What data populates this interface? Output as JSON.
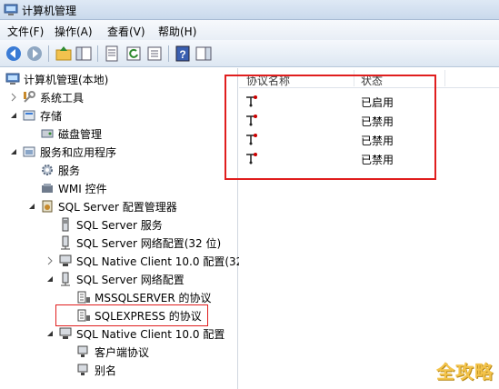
{
  "window": {
    "title": "计算机管理"
  },
  "menu": [
    "文件(F)",
    "操作(A)",
    "查看(V)",
    "帮助(H)"
  ],
  "tree": {
    "root": "计算机管理(本地)",
    "system_tools": "系统工具",
    "storage": "存储",
    "disk_mgmt": "磁盘管理",
    "services_apps": "服务和应用程序",
    "services": "服务",
    "wmi": "WMI 控件",
    "sql_config_mgr": "SQL Server 配置管理器",
    "sql_services": "SQL Server 服务",
    "sql_net_config_32": "SQL Server 网络配置(32 位)",
    "native_client_32": "SQL Native Client 10.0 配置(32",
    "sql_net_config": "SQL Server 网络配置",
    "mssqlserver_protocols": "MSSQLSERVER 的协议",
    "sqlexpress_protocols": "SQLEXPRESS 的协议",
    "native_client": "SQL Native Client 10.0 配置",
    "client_protocols": "客户端协议",
    "aliases": "别名"
  },
  "list": {
    "col_name": "协议名称",
    "col_status": "状态",
    "rows": [
      {
        "status": "已启用"
      },
      {
        "status": "已禁用"
      },
      {
        "status": "已禁用"
      },
      {
        "status": "已禁用"
      }
    ]
  },
  "watermark": "全攻略",
  "colors": {
    "highlight": "#e01e1e",
    "watermark": "#f3c34a"
  }
}
